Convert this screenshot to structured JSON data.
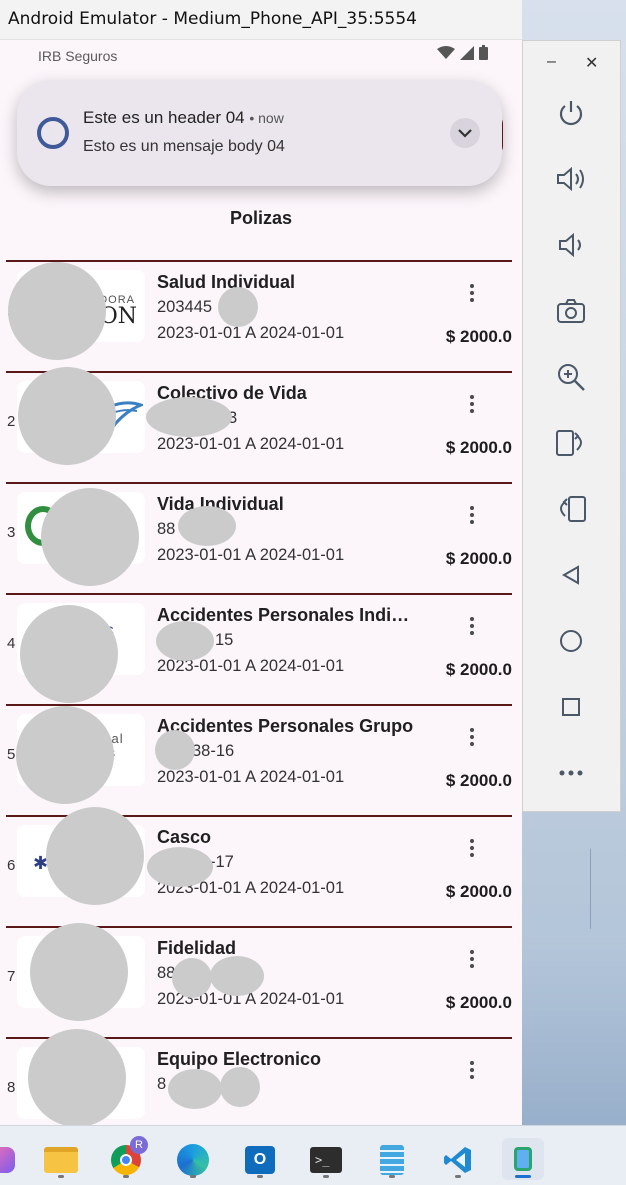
{
  "window": {
    "title": "Android Emulator - Medium_Phone_API_35:5554"
  },
  "status_bar": {
    "app_name": "IRB Seguros"
  },
  "notification": {
    "header": "Este es un header 04",
    "time": "• now",
    "body": "Esto es un mensaje body 04"
  },
  "screen": {
    "title": "Polizas"
  },
  "policies": [
    {
      "index": "1",
      "name": "Salud Individual",
      "number": "203445",
      "dates": "2023-01-01 A 2024-01-01",
      "amount": "$ 2000.0",
      "logo_text": "ON",
      "logo_small": "ADORA"
    },
    {
      "index": "2",
      "name": "Colectivo de Vida",
      "number": "3",
      "dates": "2023-01-01 A 2024-01-01",
      "amount": "$ 2000.0",
      "logo_text": "",
      "logo_small": ""
    },
    {
      "index": "3",
      "name": "Vida Individual",
      "number": "88",
      "dates": "2023-01-01 A 2024-01-01",
      "amount": "$ 2000.0",
      "logo_text": "",
      "logo_small": ""
    },
    {
      "index": "4",
      "name": "Accidentes Personales Individual",
      "number": "15",
      "dates": "2023-01-01 A 2024-01-01",
      "amount": "$ 2000.0",
      "logo_text": "",
      "logo_small": "S"
    },
    {
      "index": "5",
      "name": "Accidentes Personales Grupo",
      "number": "38-16",
      "dates": "2023-01-01 A 2024-01-01",
      "amount": "$ 2000.0",
      "logo_text": "",
      "logo_small": "onal ros"
    },
    {
      "index": "6",
      "name": "Casco",
      "number": "-17",
      "dates": "2023-01-01 A 2024-01-01",
      "amount": "$ 2000.0",
      "logo_text": "",
      "logo_small": ""
    },
    {
      "index": "7",
      "name": "Fidelidad",
      "number": "88",
      "dates": "2023-01-01 A 2024-01-01",
      "amount": "$ 2000.0",
      "logo_text": "",
      "logo_small": ""
    },
    {
      "index": "8",
      "name": "Equipo Electronico",
      "number": "8",
      "dates": "",
      "amount": "",
      "logo_text": "",
      "logo_small": ""
    }
  ],
  "side_panel": {
    "buttons": [
      "power-icon",
      "volume-up-icon",
      "volume-down-icon",
      "camera-icon",
      "zoom-icon",
      "rotate-left-icon",
      "rotate-right-icon",
      "back-icon",
      "home-icon",
      "overview-icon",
      "more-icon"
    ]
  },
  "taskbar": {
    "apps": [
      "copilot-icon",
      "file-explorer-icon",
      "chrome-icon",
      "edge-icon",
      "outlook-icon",
      "terminal-icon",
      "notepad-icon",
      "vscode-icon",
      "android-studio-icon"
    ],
    "chrome_badge": "R"
  },
  "colors": {
    "accent": "#3f5a98",
    "divider": "#5a1818",
    "background": "#fcf6fb"
  }
}
